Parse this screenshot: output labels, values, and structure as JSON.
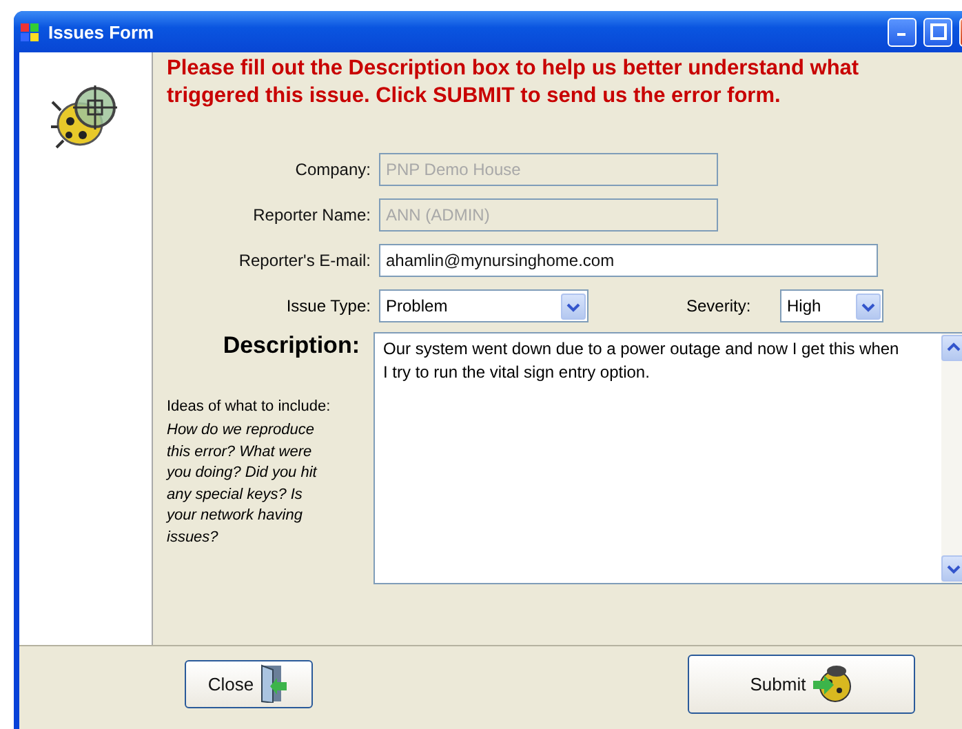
{
  "window": {
    "title": "Issues Form"
  },
  "message": "Please fill out the Description box to help us better understand what triggered this issue. Click SUBMIT to send us the error form.",
  "fields": [
    {
      "label": "Company:",
      "value": "PNP Demo House",
      "disabled": true
    },
    {
      "label": "Reporter Name:",
      "value": "ANN (ADMIN)",
      "disabled": true
    },
    {
      "label": "Reporter's E-mail:",
      "value": "ahamlin@mynursinghome.com",
      "disabled": false
    }
  ],
  "issue_type": {
    "label": "Issue Type:",
    "value": "Problem"
  },
  "severity": {
    "label": "Severity:",
    "value": "High"
  },
  "description": {
    "label": "Description:",
    "value": "Our system went down due to a power outage and now I get this when I try to run the vital sign entry option."
  },
  "ideas": {
    "heading": "Ideas of what to include:",
    "text": "How do we reproduce this error? What were you doing? Did you hit any special keys? Is your network having issues?"
  },
  "buttons": [
    {
      "kind": "close",
      "label": "Close"
    },
    {
      "kind": "submit",
      "label": "Submit"
    }
  ]
}
